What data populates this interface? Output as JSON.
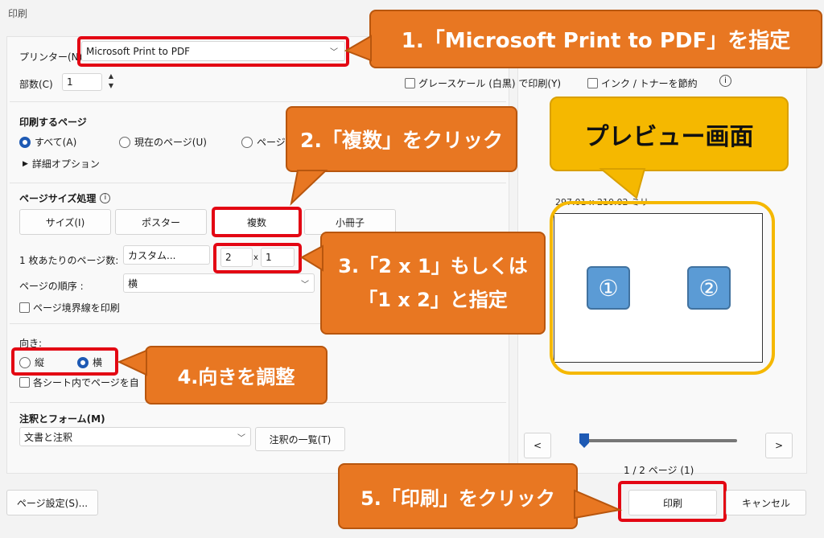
{
  "window": {
    "title": "印刷"
  },
  "printer": {
    "label": "プリンター(N)",
    "value": "Microsoft Print to PDF"
  },
  "copies": {
    "label": "部数(C)",
    "value": "1"
  },
  "options": {
    "grayscale": "グレースケール (白黒) で印刷(Y)",
    "ink_save": "インク / トナーを節約"
  },
  "pages": {
    "heading": "印刷するページ",
    "all": "すべて(A)",
    "current": "現在のページ(U)",
    "range": "ページ",
    "more": "詳細オプション"
  },
  "sizing": {
    "heading": "ページサイズ処理",
    "size": "サイズ(I)",
    "poster": "ポスター",
    "multiple": "複数",
    "booklet": "小冊子"
  },
  "multi": {
    "per_sheet_label": "1 枚あたりのページ数",
    "per_sheet_value": "カスタム...",
    "cols": "2",
    "x": "x",
    "rows": "1",
    "order_label": "ページの順序",
    "order_value": "横",
    "border": "ページ境界線を印刷"
  },
  "orientation": {
    "heading": "向き",
    "portrait": "縦",
    "landscape": "横",
    "auto": "各シート内でページを自"
  },
  "comments": {
    "heading": "注釈とフォーム(M)",
    "value": "文書と注釈",
    "summarize": "注釈の一覧(T)"
  },
  "footer": {
    "page_setup": "ページ設定(S)...",
    "print": "印刷",
    "cancel": "キャンセル"
  },
  "preview": {
    "dimensions": "297.01 x 210.02 ミリ",
    "page1": "①",
    "page2": "②",
    "prev": "<",
    "next": ">",
    "page_count": "1 / 2 ページ (1)",
    "page_fraction": 0.0
  },
  "annotations": {
    "a1": "1.「Microsoft Print to PDF」を指定",
    "a2": "2.「複数」をクリック",
    "a3_line1": "3.「2 x 1」もしくは",
    "a3_line2": "「1 x 2」と指定",
    "a4": "4.向きを調整",
    "a5": "5.「印刷」をクリック",
    "preview_label": "プレビュー画面"
  },
  "colors": {
    "callout": "#e87722",
    "callout_border": "#b8560e",
    "red_highlight": "#e30613",
    "preview_callout": "#f5b800",
    "preview_ring": "#f5b800",
    "page_number_box": "#5b9bd5"
  }
}
